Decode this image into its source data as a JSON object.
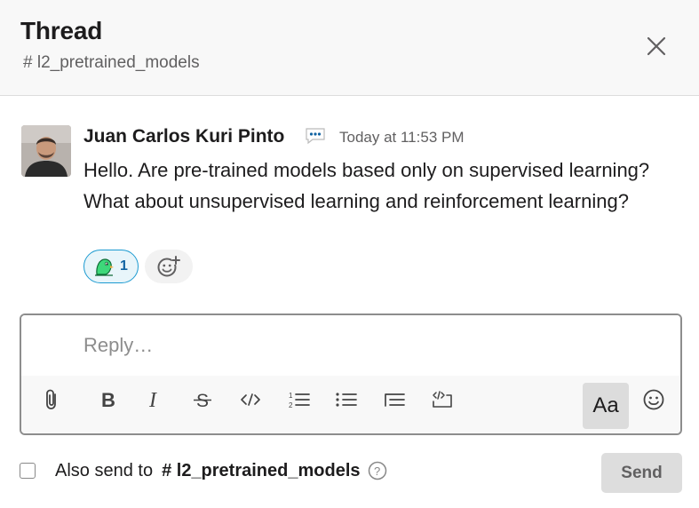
{
  "header": {
    "title": "Thread",
    "channel": "# l2_pretrained_models",
    "close_icon": "close-icon"
  },
  "message": {
    "author": "Juan Carlos Kuri Pinto",
    "status_icon": "speech-bubble-icon",
    "timestamp": "Today at 11:53 PM",
    "text": "Hello. Are pre-trained models based only on supervised learning? What about unsupervised learning and reinforcement learning?",
    "reaction": {
      "emoji_icon": "parrot-emoji-icon",
      "count": "1"
    },
    "add_reaction_icon": "add-emoji-icon"
  },
  "composer": {
    "placeholder": "Reply…",
    "value": "",
    "toolbar": [
      "attach-icon",
      "bold-icon",
      "italic-icon",
      "strikethrough-icon",
      "code-icon",
      "ordered-list-icon",
      "bulleted-list-icon",
      "blockquote-icon",
      "code-block-icon"
    ],
    "format_label": "Aa",
    "emoji_icon": "emoji-icon"
  },
  "footer": {
    "also_send_label": "Also send to",
    "channel": "# l2_pretrained_models",
    "checked": false,
    "send_label": "Send"
  },
  "colors": {
    "reaction_border": "#1d9bd1",
    "reaction_bg": "#e8f5fa",
    "header_bg": "#f8f8f8",
    "send_bg": "#dddddd"
  }
}
